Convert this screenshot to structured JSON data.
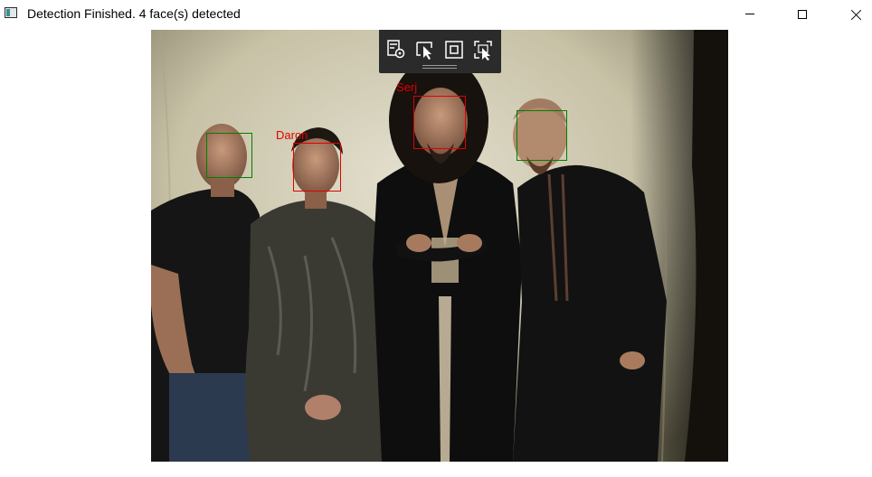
{
  "window": {
    "title": "Detection Finished. 4 face(s) detected",
    "icon": "app-window-icon"
  },
  "toolbar": {
    "tools": [
      {
        "icon": "select-settings-icon"
      },
      {
        "icon": "cursor-select-icon"
      },
      {
        "icon": "square-select-icon"
      },
      {
        "icon": "region-select-icon"
      }
    ]
  },
  "detections": [
    {
      "label": "",
      "color": "#008000"
    },
    {
      "label": "Daron",
      "color": "#e00000"
    },
    {
      "label": "Serj",
      "color": "#e00000"
    },
    {
      "label": "",
      "color": "#008000"
    }
  ],
  "colors": {
    "recognized": "#e00000",
    "unrecognized": "#008000",
    "toolbar_bg": "#2b2b2b"
  }
}
